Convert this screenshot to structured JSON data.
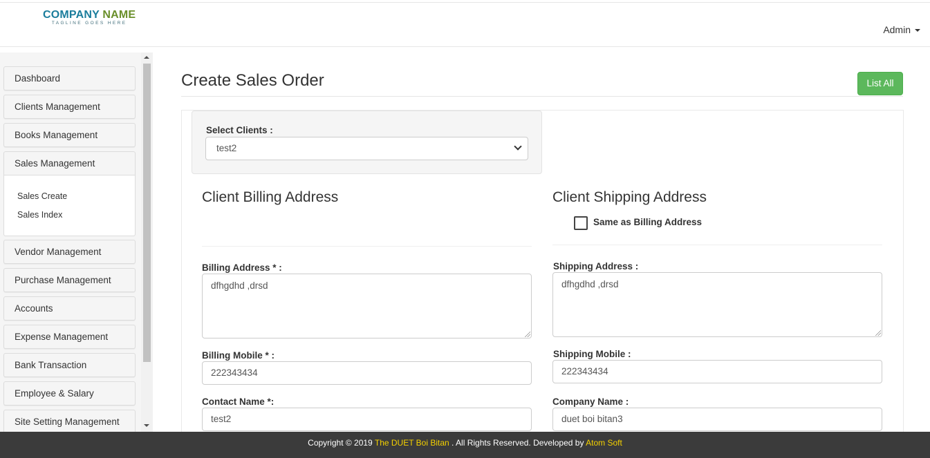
{
  "header": {
    "logo_main_1": "COMPANY",
    "logo_main_2": "NAME",
    "logo_tagline": "TAGLINE GOES HERE",
    "user_menu": "Admin"
  },
  "sidebar": {
    "items": [
      {
        "label": "Dashboard"
      },
      {
        "label": "Clients Management"
      },
      {
        "label": "Books Management"
      },
      {
        "label": "Sales Management"
      },
      {
        "label": "Vendor Management"
      },
      {
        "label": "Purchase Management"
      },
      {
        "label": "Accounts"
      },
      {
        "label": "Expense Management"
      },
      {
        "label": "Bank Transaction"
      },
      {
        "label": "Employee & Salary"
      },
      {
        "label": "Site Setting Management"
      }
    ],
    "sales_sub": [
      {
        "label": "Sales Create"
      },
      {
        "label": "Sales Index"
      }
    ]
  },
  "main": {
    "title": "Create Sales Order",
    "list_all_button": "List All",
    "select_client_label": "Select Clients :",
    "select_client_value": "test2",
    "billing": {
      "heading": "Client Billing Address",
      "address_label": "Billing Address * :",
      "address_value": "dfhgdhd ,drsd",
      "mobile_label": "Billing Mobile * :",
      "mobile_value": "222343434",
      "contact_label": "Contact Name *:",
      "contact_value": "test2"
    },
    "shipping": {
      "heading": "Client Shipping Address",
      "same_as_billing_label": "Same as Billing Address",
      "same_as_billing_checked": false,
      "address_label": "Shipping Address :",
      "address_value": "dfhgdhd ,drsd",
      "mobile_label": "Shipping Mobile :",
      "mobile_value": "222343434",
      "company_label": "Company Name :",
      "company_value": "duet boi bitan3"
    }
  },
  "footer": {
    "prefix": "Copyright © 2019",
    "site": "The DUET Boi Bitan",
    "middle": ". All Rights Reserved. Developed by",
    "developer": "Atom Soft"
  },
  "colors": {
    "primary_button": "#5cb85c",
    "footer_bg": "#3b3b3b",
    "footer_highlight": "#f5d100",
    "logo_blue": "#1b7d9c",
    "logo_green": "#6a8f2a"
  }
}
